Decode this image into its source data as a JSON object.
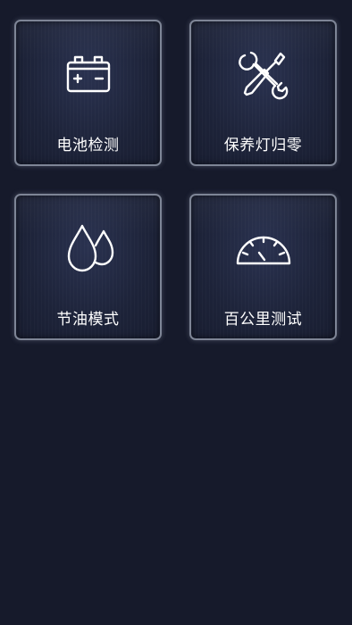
{
  "tiles": [
    {
      "id": "battery",
      "label": "电池检测",
      "icon": "battery-icon"
    },
    {
      "id": "maintenance",
      "label": "保养灯归零",
      "icon": "wrench-screwdriver-icon"
    },
    {
      "id": "fuel",
      "label": "节油模式",
      "icon": "water-drops-icon"
    },
    {
      "id": "acceleration",
      "label": "百公里测试",
      "icon": "speedometer-icon"
    }
  ],
  "colors": {
    "background": "#161a2b",
    "tile_border": "#7e8596",
    "icon_stroke": "#ffffff",
    "label_text": "#ffffff"
  }
}
